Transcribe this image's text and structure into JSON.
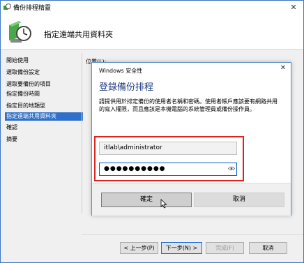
{
  "window": {
    "title": "備份排程精靈",
    "close_glyph": "✕"
  },
  "header": {
    "title": "指定遠端共用資料夾",
    "icon": "backup-clock-icon"
  },
  "nav": {
    "items": [
      {
        "label": "開始使用",
        "selected": false
      },
      {
        "label": "選取備份設定",
        "selected": false
      },
      {
        "label": "選取要備份的項目",
        "selected": false
      },
      {
        "label": "指定備份時間",
        "selected": false
      },
      {
        "label": "指定目的地類型",
        "selected": false
      },
      {
        "label": "指定遠端共用資料夾",
        "selected": true
      },
      {
        "label": "確認",
        "selected": false
      },
      {
        "label": "摘要",
        "selected": false
      }
    ]
  },
  "main": {
    "location_label": "位置(L):"
  },
  "wizard_buttons": {
    "back": "< 上一步(P)",
    "next": "下一步(N) >",
    "finish": "完成(F)",
    "cancel": "取消"
  },
  "credential_dialog": {
    "title": "Windows 安全性",
    "close_glyph": "✕",
    "heading": "登錄備份排程",
    "description": "請提供用於排定備份的使用者名稱和密碼。使用者帳戶應該要有網路共用的寫入權限，而且應該是本機電腦的系統管理員或備份操作員。",
    "username": "itlab\\administrator",
    "password_mask": "●●●●●●●●●●",
    "ok": "確定",
    "cancel": "取消"
  },
  "colors": {
    "accent": "#3070c8",
    "highlight_box": "#d9251d",
    "dialog_heading": "#1e3b80"
  }
}
